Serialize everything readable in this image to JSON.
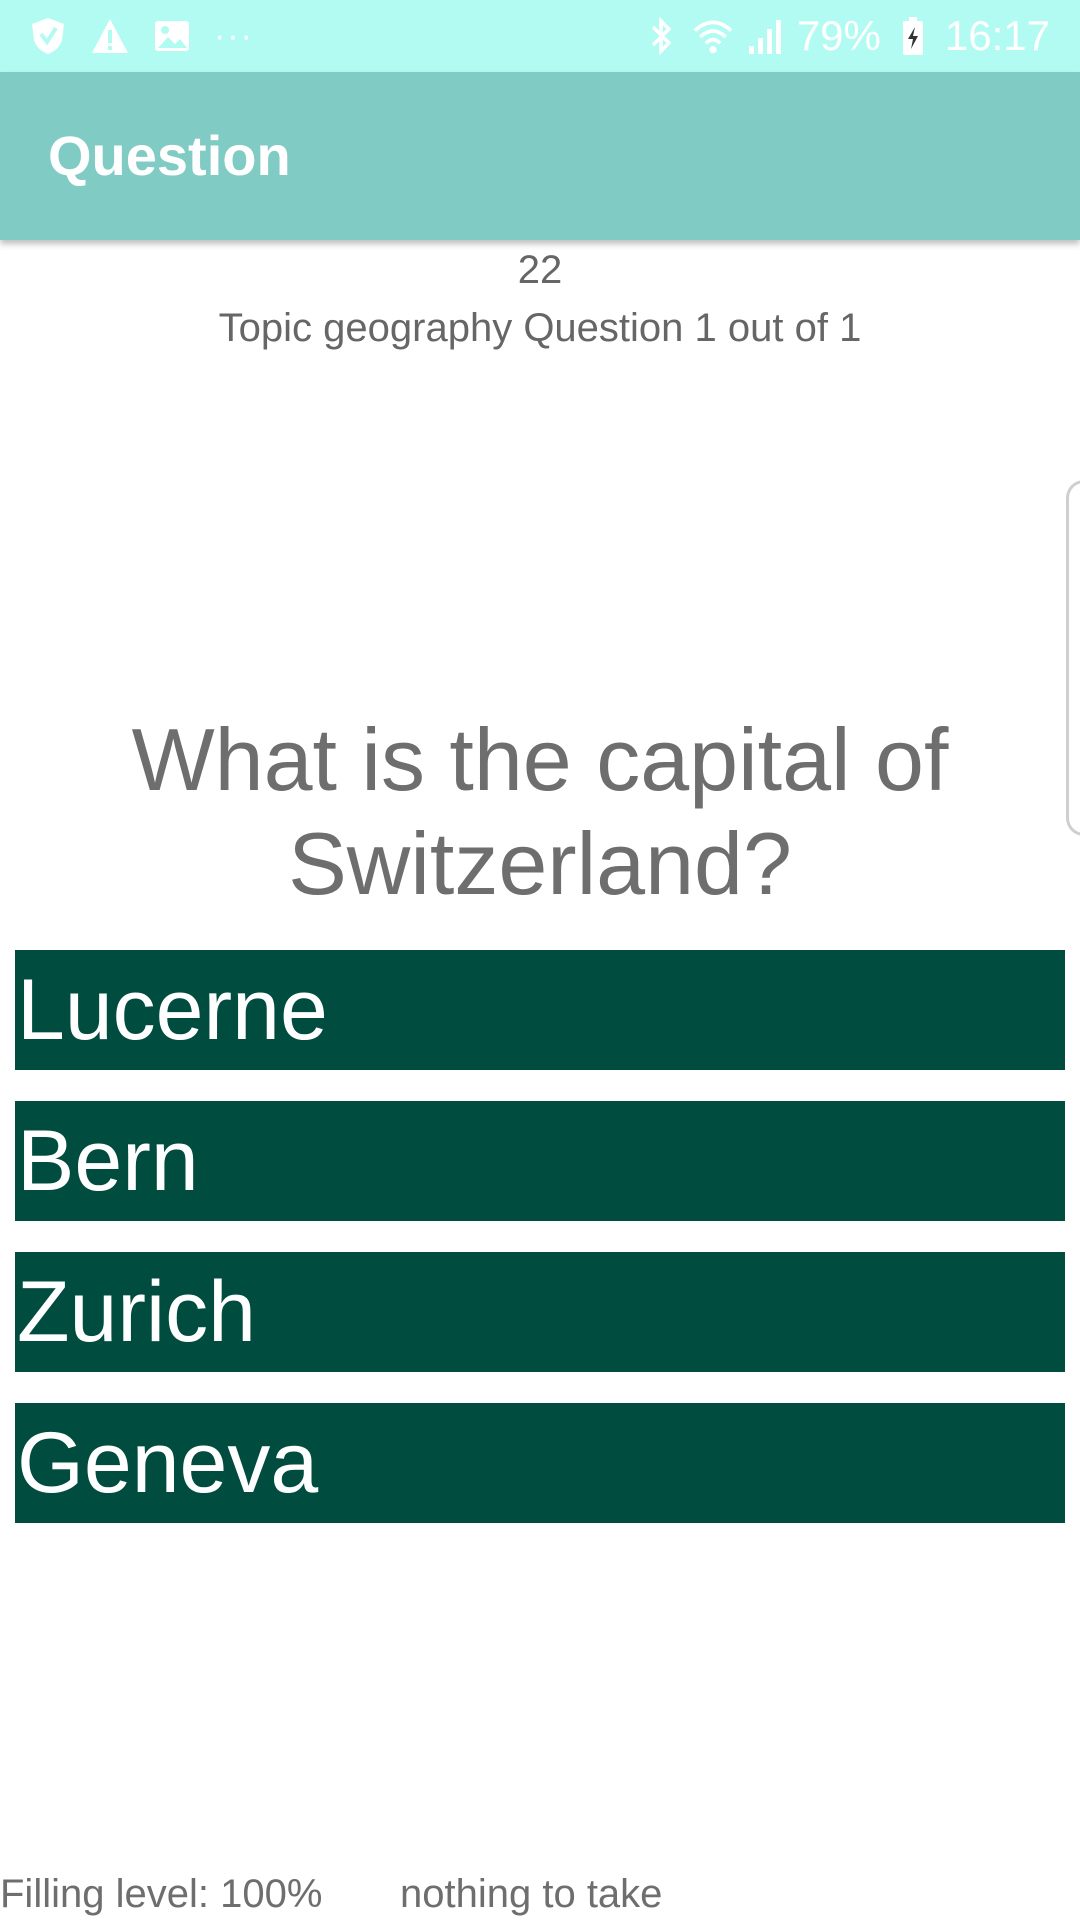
{
  "status_bar": {
    "battery_percent": "79%",
    "time": "16:17",
    "left_icons": [
      "shield-icon",
      "warning-icon",
      "image-icon",
      "more-dots-icon"
    ],
    "right_icons": [
      "bluetooth-icon",
      "wifi-icon",
      "signal-icon",
      "battery-charging-icon"
    ],
    "more_dots": "···"
  },
  "app_bar": {
    "title": "Question"
  },
  "header": {
    "counter": "22",
    "topic_line": "Topic geography Question 1 out of 1"
  },
  "question": {
    "text": "What is the capital of Switzerland?"
  },
  "answers": [
    {
      "label": "Lucerne"
    },
    {
      "label": "Bern"
    },
    {
      "label": "Zurich"
    },
    {
      "label": "Geneva"
    }
  ],
  "footer": {
    "filling_level": "Filling level: 100%",
    "status": "nothing to take"
  },
  "colors": {
    "status_bar_bg": "#b2fbf2",
    "app_bar_bg": "#80cbc4",
    "answer_bg": "#004d40",
    "text_gray": "#6e6e6e"
  }
}
